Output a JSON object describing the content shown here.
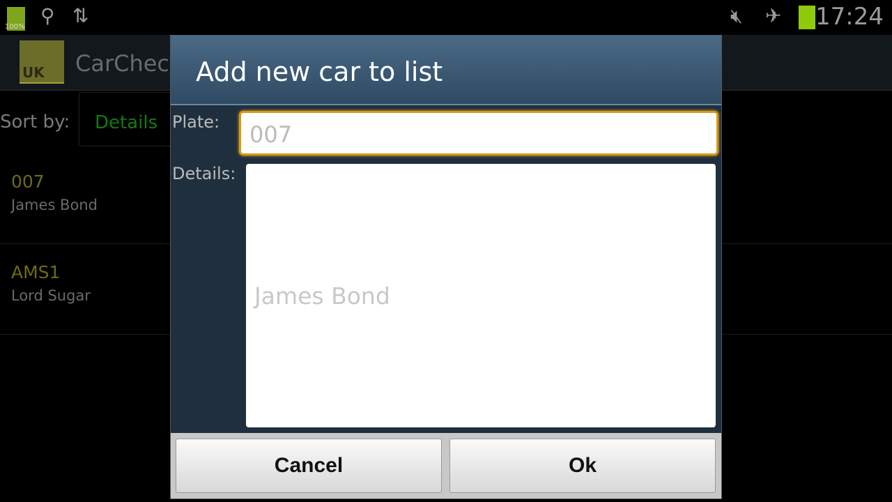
{
  "status_bar": {
    "battery_percent_label": "100%",
    "time": "17:24",
    "icons": [
      "battery-icon",
      "usb-icon",
      "sync-icon",
      "mute-icon",
      "airplane-icon",
      "battery-icon"
    ]
  },
  "app": {
    "title": "CarCheck",
    "logo_text": "UK"
  },
  "sort": {
    "label": "Sort by:",
    "value": "Details"
  },
  "list": [
    {
      "plate": "007",
      "details": "James Bond"
    },
    {
      "plate": "AMS1",
      "details": "Lord Sugar"
    }
  ],
  "dialog": {
    "title": "Add new car to list",
    "plate_label": "Plate:",
    "plate_value": "007",
    "details_label": "Details:",
    "details_value": "James Bond",
    "cancel": "Cancel",
    "ok": "Ok"
  }
}
